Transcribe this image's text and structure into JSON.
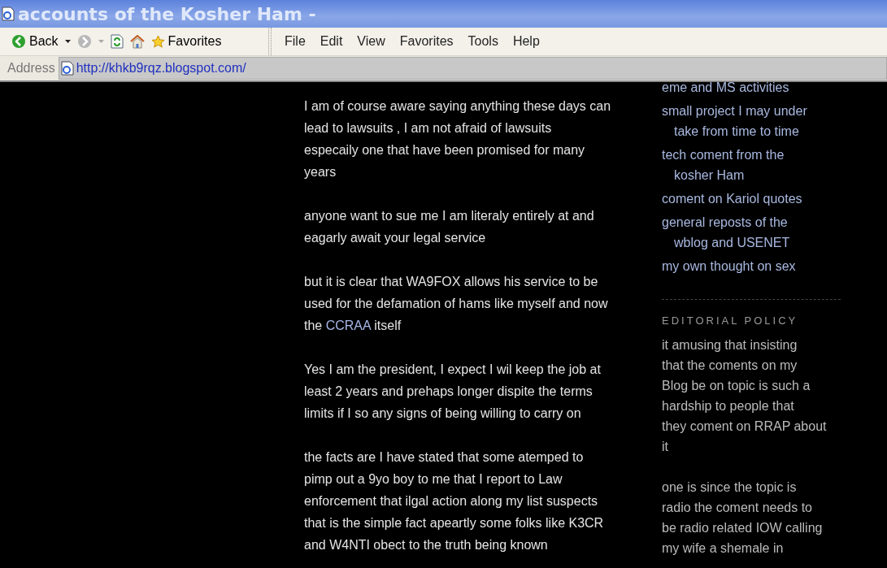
{
  "window": {
    "title": "accounts of the Kosher Ham -"
  },
  "toolbar": {
    "back": "Back",
    "favorites": "Favorites"
  },
  "menu": [
    "File",
    "Edit",
    "View",
    "Favorites",
    "Tools",
    "Help"
  ],
  "address_bar": {
    "label": "Address",
    "url": "http://khkb9rqz.blogspot.com/"
  },
  "post": {
    "paragraphs": [
      {
        "text": "I am of course aware saying anything these days can\nlead to lawsuits , I am not afraid of lawsuits\nespecaily one that have been promised for many\nyears"
      },
      {
        "text": "anyone want to sue me I am literaly entirely at and\neagarly await your legal service"
      },
      {
        "text": "but it is clear that WA9FOX allows his service to be\nused for the defamation of hams like myself and now\nthe ",
        "link": "CCRAA",
        "after": " itself"
      },
      {
        "text": "Yes I am the president, I expect I wil keep the job at\nleast 2 years and prehaps longer dispite the terms\nlimits if I so any signs of being willing to carry on"
      },
      {
        "text": "the facts are I have stated that some atemped to\npimp out a 9yo boy to me that I report to Law\nenforcement that ilgal action along my list suspects\nthat is the simple fact apeartly some folks like K3CR\nand W4NTI obect to the truth being known"
      }
    ]
  },
  "sidebar": {
    "links": [
      "eme and MS activities",
      "small project I may under\ntake from time to time",
      "tech coment from the\nkosher Ham",
      "coment on Kariol quotes",
      "general reposts of the\nwblog and USENET",
      "my own thought on sex"
    ],
    "heading": "EDITORIAL POLICY",
    "paragraphs": [
      "it amusing that insisting\nthat the coments on my\nBlog be on topic is such a\nhardship to people that\nthey coment on RRAP about\nit",
      "one is since the topic is\nradio the coment needs to\nbe radio related IOW calling\nmy wife a shemale in"
    ]
  }
}
